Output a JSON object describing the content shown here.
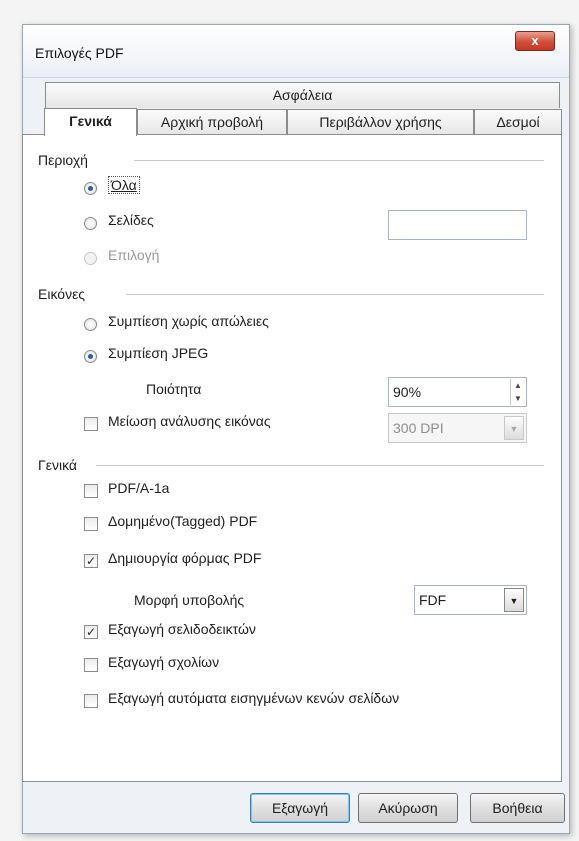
{
  "window": {
    "title": "Επιλογές PDF",
    "close_label": "x"
  },
  "tabs": {
    "row1": [
      {
        "label": "Ασφάλεια"
      }
    ],
    "row2": [
      {
        "label": "Γενικά"
      },
      {
        "label": "Αρχική προβολή"
      },
      {
        "label": "Περιβάλλον χρήσης"
      },
      {
        "label": "Δεσμοί"
      }
    ],
    "active": "Γενικά"
  },
  "area": {
    "title": "Περιοχή",
    "all_label": "Όλα",
    "pages_label": "Σελίδες",
    "pages_value": "",
    "selection_label": "Επιλογή",
    "selected": "Όλα"
  },
  "images": {
    "title": "Εικόνες",
    "lossless_label": "Συμπίεση χωρίς απώλειες",
    "jpeg_label": "Συμπίεση JPEG",
    "selected": "Συμπίεση JPEG",
    "quality_label": "Ποιότητα",
    "quality_value": "90%",
    "reduce_label": "Μείωση ανάλυσης εικόνας",
    "reduce_checked": false,
    "dpi_value": "300 DPI"
  },
  "general": {
    "title": "Γενικά",
    "pdfa_label": "PDF/A-1a",
    "pdfa_checked": false,
    "tagged_label": "Δομημένο(Tagged) PDF",
    "tagged_checked": false,
    "form_label": "Δημιουργία φόρμας PDF",
    "form_checked": true,
    "submit_format_label": "Μορφή υποβολής",
    "submit_format_value": "FDF",
    "bookmarks_label": "Εξαγωγή σελιδοδεικτών",
    "bookmarks_checked": true,
    "comments_label": "Εξαγωγή σχολίων",
    "comments_checked": false,
    "blank_pages_label": "Εξαγωγή αυτόματα εισηγμένων κενών σελίδων",
    "blank_pages_checked": false
  },
  "buttons": {
    "export": "Εξαγωγή",
    "cancel": "Ακύρωση",
    "help": "Βοήθεια"
  },
  "icons": {
    "checkmark": "✓",
    "spin_up": "▲",
    "spin_down": "▼",
    "dropdown": "▼"
  },
  "colors": {
    "accent": "#2d5fa8",
    "close": "#c23a25"
  }
}
